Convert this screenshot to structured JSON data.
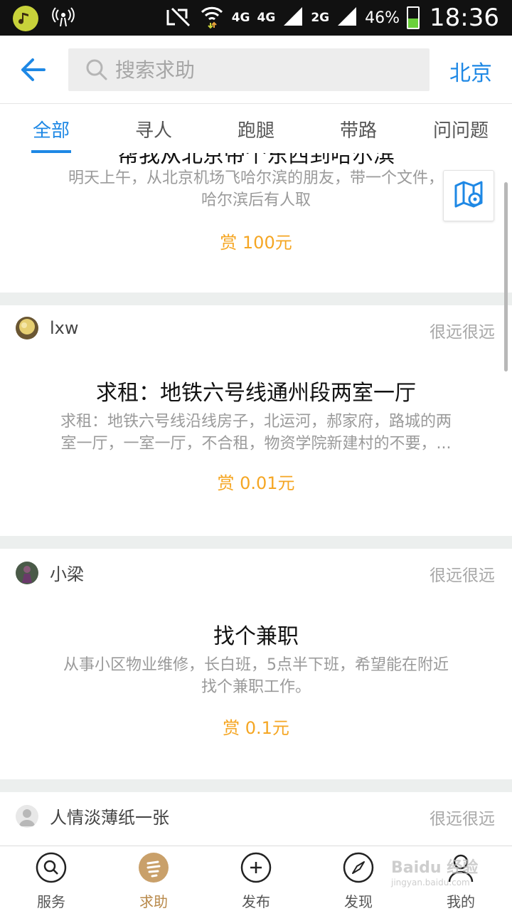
{
  "status_bar": {
    "net1": "4G",
    "net2": "4G",
    "net3": "2G",
    "battery_text": "46%",
    "battery_level": 0.46,
    "time": "18:36"
  },
  "header": {
    "search_placeholder": "搜索求助",
    "city": "北京"
  },
  "tabs": [
    {
      "label": "全部",
      "active": true
    },
    {
      "label": "寻人",
      "active": false
    },
    {
      "label": "跑腿",
      "active": false
    },
    {
      "label": "带路",
      "active": false
    },
    {
      "label": "问问题",
      "active": false
    }
  ],
  "posts": [
    {
      "title": "帮我从北京带个东西到哈尔滨",
      "desc_line1": "明天上午，从北京机场飞哈尔滨的朋友，带一个文件，",
      "desc_line2": "哈尔滨后有人取",
      "reward": "赏 100元"
    },
    {
      "username": "lxw",
      "distance": "很远很远",
      "title": "求租：地铁六号线通州段两室一厅",
      "desc_line1": "求租：地铁六号线沿线房子，北运河，郝家府，路城的两",
      "desc_line2": "室一厅，一室一厅，不合租，物资学院新建村的不要，...",
      "reward": "赏 0.01元"
    },
    {
      "username": "小梁",
      "distance": "很远很远",
      "title": "找个兼职",
      "desc_line1": "从事小区物业维修，长白班，5点半下班，希望能在附近",
      "desc_line2": "找个兼职工作。",
      "reward": "赏 0.1元"
    },
    {
      "username": "人情淡薄纸一张",
      "distance": "很远很远"
    }
  ],
  "bottom_nav": [
    {
      "label": "服务",
      "icon": "search-icon"
    },
    {
      "label": "求助",
      "icon": "help-hand-icon",
      "active": true
    },
    {
      "label": "发布",
      "icon": "plus-circle-icon"
    },
    {
      "label": "发现",
      "icon": "compass-icon"
    },
    {
      "label": "我的",
      "icon": "user-icon"
    }
  ],
  "watermark": {
    "brand": "Baidu 经验",
    "url": "jingyan.baidu.com"
  },
  "colors": {
    "accent": "#1e88e5",
    "reward": "#f5a623",
    "active_nav": "#b8894a"
  }
}
